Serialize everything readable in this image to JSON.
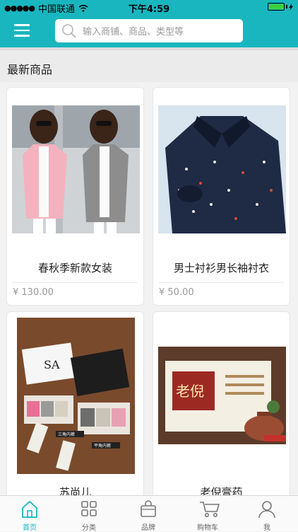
{
  "status_bar": {
    "carrier": "中国联通",
    "time": "下午4:59"
  },
  "search": {
    "placeholder": "输入商铺、商品、类型等"
  },
  "section": {
    "title": "最新商品"
  },
  "products": [
    {
      "name": "春秋季新款女装",
      "price": "¥ 130.00"
    },
    {
      "name": "男士衬衫男长袖衬衣",
      "price": "¥ 50.00"
    },
    {
      "name": "苏尚儿",
      "price": ""
    },
    {
      "name": "老倪膏药",
      "price": ""
    }
  ],
  "product_images": {
    "underwear_box_brand": "SA",
    "underwear_tag_1": "三角内裤",
    "underwear_tag_2": "平角内裤",
    "medicine_brand": "老倪"
  },
  "tabbar": [
    {
      "label": "首页",
      "icon": "home-icon",
      "active": true
    },
    {
      "label": "分类",
      "icon": "grid-icon",
      "active": false
    },
    {
      "label": "品牌",
      "icon": "bag-icon",
      "active": false
    },
    {
      "label": "购物车",
      "icon": "cart-icon",
      "active": false
    },
    {
      "label": "我",
      "icon": "user-icon",
      "active": false
    }
  ],
  "colors": {
    "accent": "#19b6bf",
    "battery": "#3ad13a",
    "price": "#999999"
  }
}
